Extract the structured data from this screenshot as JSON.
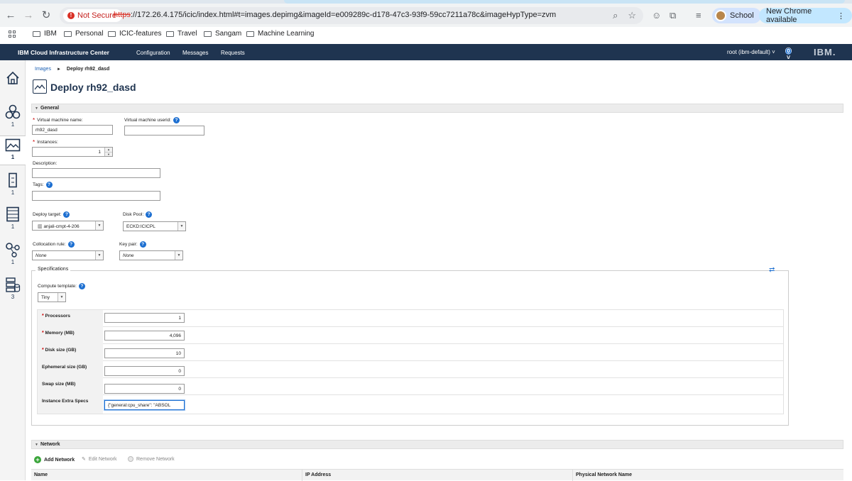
{
  "browser": {
    "not_secure": "Not Secure",
    "url_scheme": "https",
    "url_rest": "://172.26.4.175/icic/index.html#t=images.depimg&imageId=e009289c-d178-47c3-93f9-59cc7211a78c&imageHypType=zvm",
    "profile": "School",
    "update_label": "New Chrome available"
  },
  "bookmarks": [
    "IBM",
    "Personal",
    "ICIC-features",
    "Travel",
    "Sangam",
    "Machine Learning"
  ],
  "appbar": {
    "brand": "IBM Cloud Infrastructure Center",
    "menu": [
      "Configuration",
      "Messages",
      "Requests"
    ],
    "user": "root (ibm-default)",
    "logo": "IBM."
  },
  "sidebar": {
    "counts": [
      "1",
      "1",
      "1",
      "1",
      "1",
      "3"
    ]
  },
  "breadcrumb": {
    "parent": "Images",
    "current": "Deploy rh92_dasd"
  },
  "title": "Deploy rh92_dasd",
  "general": {
    "header": "General",
    "vm_name_label": "Virtual machine name:",
    "vm_name_value": "rh92_dasd",
    "vm_userid_label": "Virtual machine userid:",
    "vm_userid_value": "",
    "instances_label": "Instances:",
    "instances_value": "1",
    "description_label": "Description:",
    "description_value": "",
    "tags_label": "Tags:",
    "tags_value": "",
    "deploy_target_label": "Deploy target:",
    "deploy_target_value": "anjali-cmpt-4-206",
    "disk_pool_label": "Disk Pool:",
    "disk_pool_value": "ECKD:ICICPL",
    "collocation_label": "Collocation rule:",
    "collocation_value": "None",
    "keypair_label": "Key pair:",
    "keypair_value": "None"
  },
  "specs": {
    "header": "Specifications",
    "template_label": "Compute template:",
    "template_value": "Tiny",
    "rows": [
      {
        "label": "Processors",
        "value": "1",
        "required": true
      },
      {
        "label": "Memory (MB)",
        "value": "4,096",
        "required": true
      },
      {
        "label": "Disk size (GB)",
        "value": "10",
        "required": true
      },
      {
        "label": "Ephemeral size (GB)",
        "value": "0",
        "required": false
      },
      {
        "label": "Swap size (MB)",
        "value": "0",
        "required": false
      },
      {
        "label": "Instance Extra Specs",
        "value": "{\"general:cpu_share\": \"ABSOL",
        "required": false
      }
    ]
  },
  "network": {
    "header": "Network",
    "add": "Add Network",
    "edit": "Edit Network",
    "remove": "Remove Network",
    "columns": [
      "Name",
      "IP Address",
      "Physical Network Name"
    ]
  },
  "colors": {
    "appbar": "#1f3450",
    "link": "#1a5fb4",
    "help": "#1d6fd1"
  }
}
